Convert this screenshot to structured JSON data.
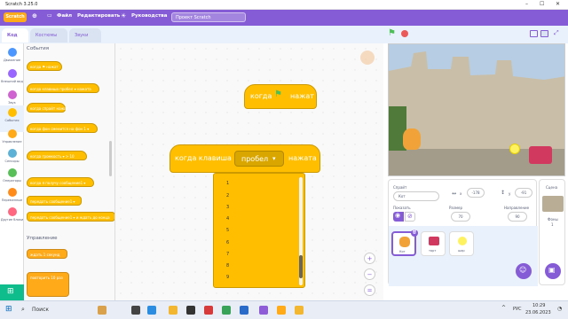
{
  "window": {
    "title": "Scratch 3.25.0"
  },
  "menubar": {
    "logo": "Scratch",
    "file": "Файл",
    "edit": "Редактировать",
    "tutorials": "Руководства",
    "project_title": "Проект Scratch"
  },
  "tabs": {
    "code": "Код",
    "costumes": "Костюмы",
    "sounds": "Звуки"
  },
  "categories": [
    {
      "label": "Движение",
      "color": "#4c97ff"
    },
    {
      "label": "Внешний вид",
      "color": "#9966ff"
    },
    {
      "label": "Звук",
      "color": "#cf63cf"
    },
    {
      "label": "События",
      "color": "#ffbf00"
    },
    {
      "label": "Управление",
      "color": "#ffab19"
    },
    {
      "label": "Сенсоры",
      "color": "#5cb1d6"
    },
    {
      "label": "Операторы",
      "color": "#59c059"
    },
    {
      "label": "Переменные",
      "color": "#ff8c1a"
    },
    {
      "label": "Другие блоки",
      "color": "#ff6680"
    }
  ],
  "palette": {
    "events_header": "События",
    "events_blocks": [
      "когда ⚑ нажат",
      "когда клавиша  пробел ▾  нажата",
      "когда спрайт нажат",
      "когда фон сменится на  фон 1 ▾",
      "когда  громкость ▾  >  10",
      "когда я получу  сообщение1 ▾",
      "передать  сообщение1 ▾",
      "передать  сообщение1 ▾  и ждать до конца"
    ],
    "control_header": "Управление",
    "control_blocks": [
      "ждать  1  секунд",
      "повторить  10  раз"
    ]
  },
  "scripts": {
    "hat1": {
      "prefix": "когда",
      "suffix": "нажат"
    },
    "hat2": {
      "prefix": "когда клавиша",
      "key": "пробел",
      "suffix": "нажата"
    },
    "dropdown_items": [
      "1",
      "2",
      "3",
      "4",
      "5",
      "6",
      "7",
      "8",
      "9"
    ],
    "zoom_in": "+",
    "zoom_out": "−",
    "zoom_reset": "="
  },
  "sprite_info": {
    "sprite_label": "Спрайт",
    "sprite_name": "Кот",
    "x": "-178",
    "y": "-91",
    "show_label": "Показать",
    "size_label": "Размер",
    "size": "70",
    "direction_label": "Направление",
    "direction": "90"
  },
  "sprites": [
    {
      "name": "Кот"
    },
    {
      "name": "торт"
    },
    {
      "name": "шар"
    }
  ],
  "stage_panel": {
    "title": "Сцена",
    "backdrops_label": "Фоны",
    "backdrops_count": "1"
  },
  "taskbar": {
    "search": "Поиск",
    "lang": "РУС",
    "time": "10:29",
    "date": "23.06.2023"
  },
  "colors": {
    "accent": "#855cd6",
    "events": "#ffbf00",
    "control": "#ffab19"
  }
}
